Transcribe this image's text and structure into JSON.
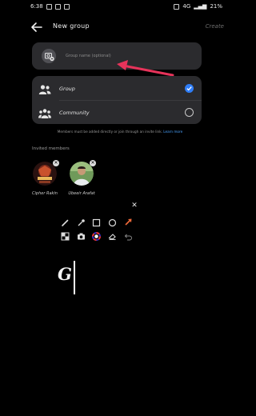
{
  "status": {
    "time": "6:38",
    "battery": "21%",
    "network": "4G"
  },
  "header": {
    "title": "New group",
    "create_label": "Create"
  },
  "group_name": {
    "placeholder": "Group name (optional)"
  },
  "types": [
    {
      "label": "Group",
      "selected": true
    },
    {
      "label": "Community",
      "selected": false
    }
  ],
  "note": {
    "text": "Members must be added directly or join through an invite link.",
    "link": "Learn more"
  },
  "invited": {
    "label": "Invited members",
    "members": [
      {
        "name": "Cipher Rakin"
      },
      {
        "name": "Ubeeir Arafat"
      }
    ]
  },
  "editor": {
    "typed_text": "G",
    "tools_row1": [
      "pen-icon",
      "eyedropper-icon",
      "square-icon",
      "circle-icon",
      "arrow-icon"
    ],
    "tools_row2": [
      "mosaic-icon",
      "camera-icon",
      "color-wheel-icon",
      "eraser-icon",
      "undo-icon"
    ],
    "accent": "#f06a3a"
  },
  "colors": {
    "accent_blue": "#2f7df6",
    "arrow_red": "#e6335a"
  }
}
